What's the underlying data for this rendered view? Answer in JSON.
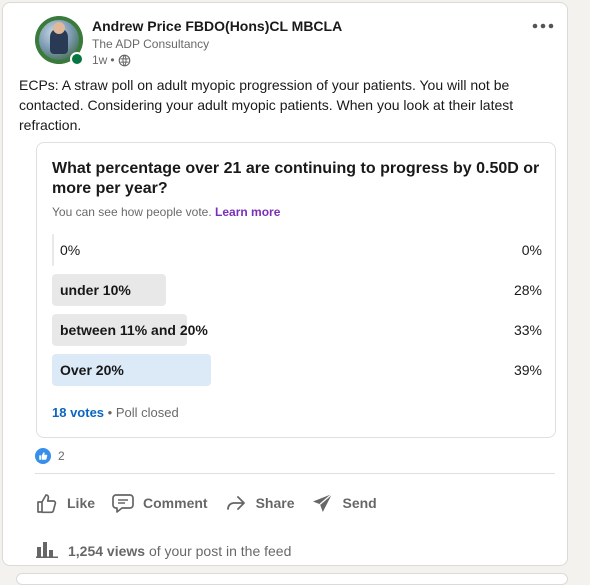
{
  "post": {
    "author_name": "Andrew Price FBDO(Hons)CL MBCLA",
    "author_headline": "The ADP Consultancy",
    "time_ago": "1w",
    "time_separator": "•",
    "visibility_icon": "globe-icon",
    "more_icon": "more-horizontal-icon",
    "text": "ECPs: A straw poll on adult myopic progression of your patients. You will not be contacted. Considering your adult myopic patients. When you look at their latest refraction."
  },
  "poll": {
    "question": "What percentage over 21 are continuing to progress by 0.50D or more per year?",
    "note": "You can see how people vote.",
    "learn_more": "Learn more",
    "options": [
      {
        "label": "0%",
        "percent_text": "0%",
        "percent": 0,
        "selected": false
      },
      {
        "label": "under 10%",
        "percent_text": "28%",
        "percent": 28,
        "selected": false
      },
      {
        "label": "between 11% and 20%",
        "percent_text": "33%",
        "percent": 33,
        "selected": false
      },
      {
        "label": "Over 20%",
        "percent_text": "39%",
        "percent": 39,
        "selected": true
      }
    ],
    "votes": "18 votes",
    "status": "• Poll closed"
  },
  "social": {
    "reaction_icon": "like-reaction-icon",
    "reaction_count": "2"
  },
  "actions": {
    "like": "Like",
    "comment": "Comment",
    "share": "Share",
    "send": "Send"
  },
  "views": {
    "icon": "analytics-bar-icon",
    "count": "1,254 views",
    "suffix": "of your post in the feed"
  },
  "colors": {
    "link_blue": "#0a66c2",
    "learn_more_purple": "#7b2fb8",
    "selected_fill": "#dce9f7",
    "option_fill": "#e8e8e8",
    "online_green": "#057642",
    "like_blue": "#378fe9"
  }
}
